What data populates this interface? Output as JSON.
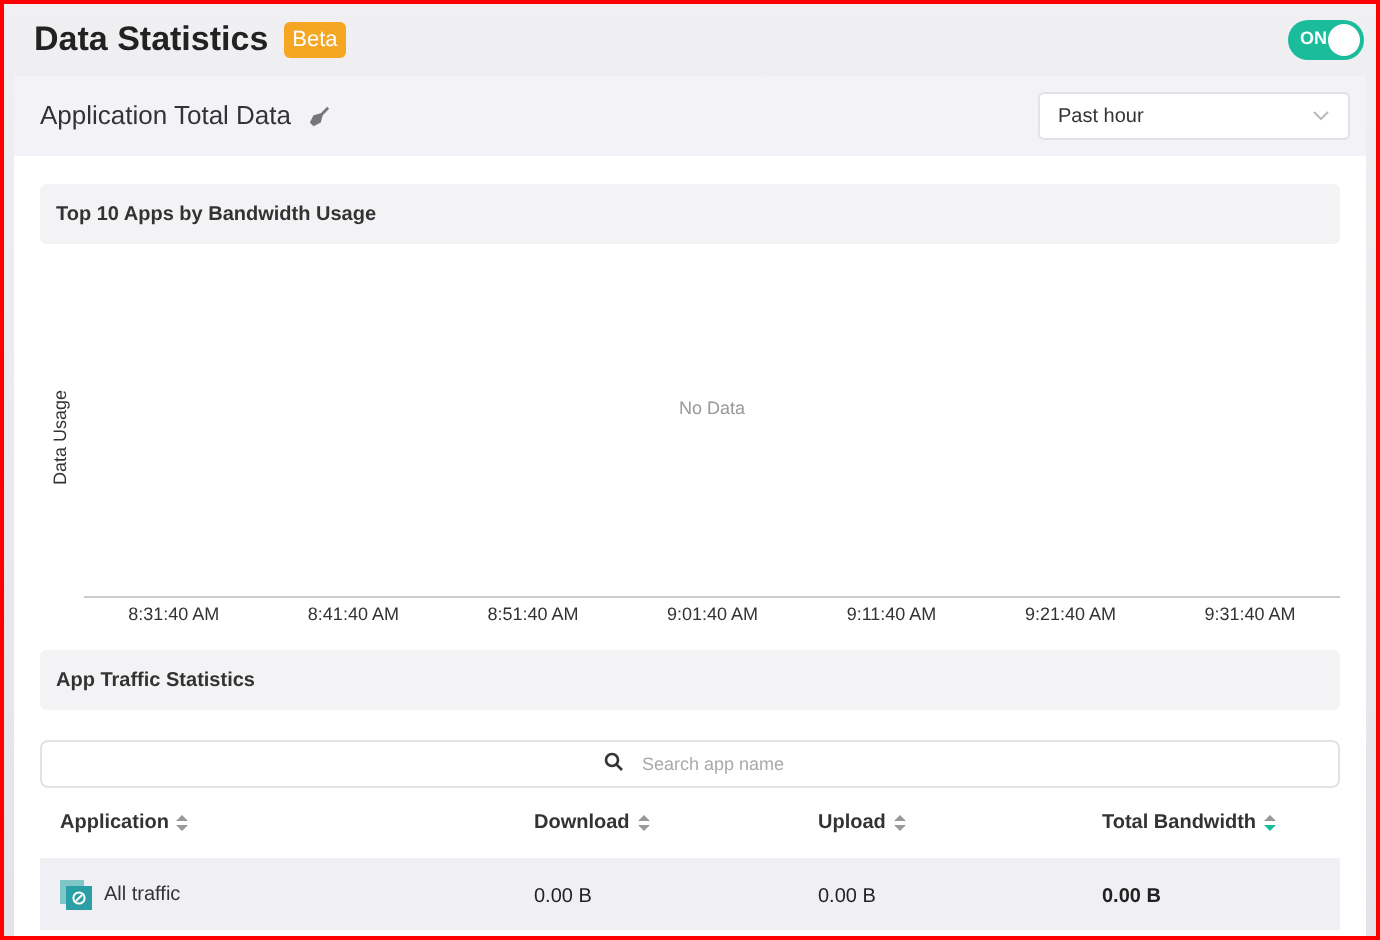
{
  "header": {
    "title": "Data Statistics",
    "badge": "Beta",
    "toggle": {
      "label": "ON",
      "on": true
    }
  },
  "card": {
    "title": "Application Total Data",
    "range_select": {
      "value": "Past hour"
    }
  },
  "chart_section": {
    "title": "Top 10 Apps by Bandwidth Usage",
    "y_axis_label": "Data Usage",
    "empty_text": "No Data",
    "x_tick_labels": [
      "8:31:40 AM",
      "8:41:40 AM",
      "8:51:40 AM",
      "9:01:40 AM",
      "9:11:40 AM",
      "9:21:40 AM",
      "9:31:40 AM"
    ]
  },
  "traffic_section": {
    "title": "App Traffic Statistics",
    "search": {
      "placeholder": "Search app name"
    },
    "columns": [
      {
        "label": "Application",
        "sorted": false
      },
      {
        "label": "Download",
        "sorted": false
      },
      {
        "label": "Upload",
        "sorted": false
      },
      {
        "label": "Total Bandwidth",
        "sorted": true
      }
    ],
    "rows": [
      {
        "application": "All traffic",
        "download": "0.00 B",
        "upload": "0.00 B",
        "total": "0.00 B"
      }
    ]
  }
}
